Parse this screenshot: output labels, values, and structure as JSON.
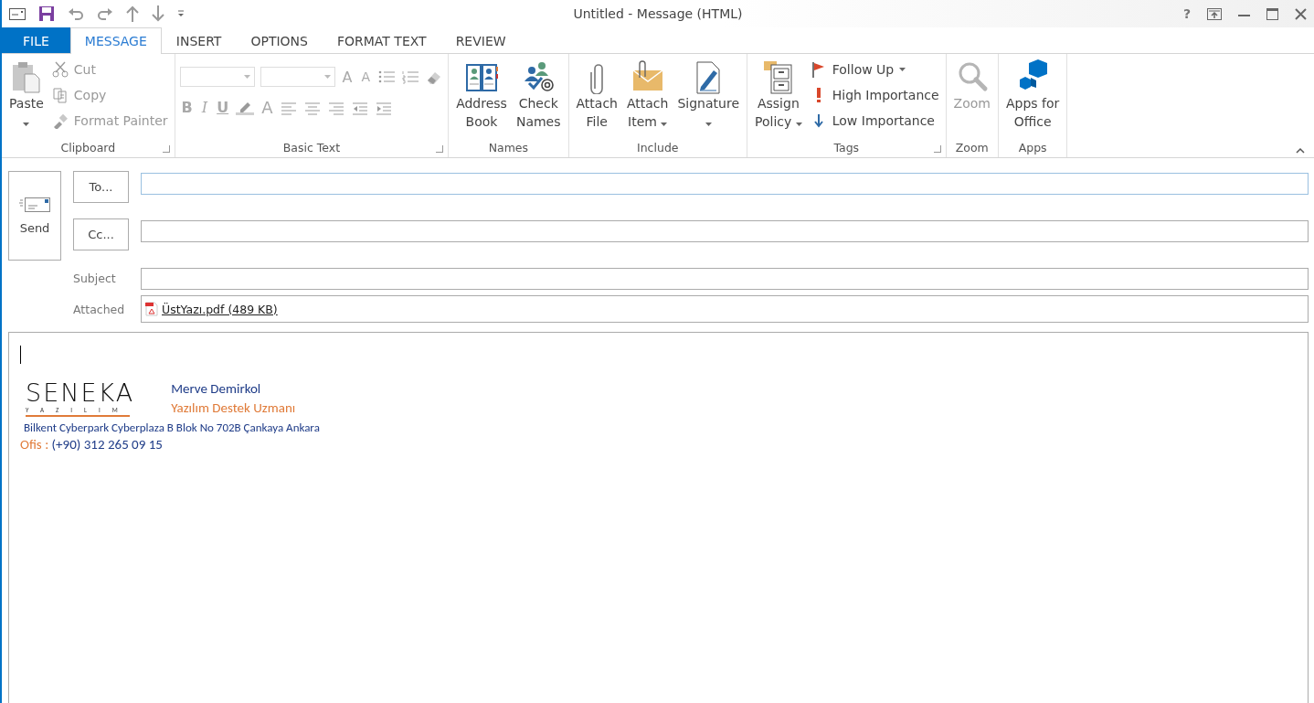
{
  "window": {
    "title": "Untitled - Message (HTML)",
    "help": "?"
  },
  "tabs": [
    {
      "label": "FILE",
      "kind": "file",
      "selected": false
    },
    {
      "label": "MESSAGE",
      "kind": "tab",
      "selected": true
    },
    {
      "label": "INSERT",
      "kind": "tab",
      "selected": false
    },
    {
      "label": "OPTIONS",
      "kind": "tab",
      "selected": false
    },
    {
      "label": "FORMAT TEXT",
      "kind": "tab",
      "selected": false
    },
    {
      "label": "REVIEW",
      "kind": "tab",
      "selected": false
    }
  ],
  "ribbon": {
    "groups": [
      {
        "label": "Clipboard",
        "launcher": true,
        "items": [
          {
            "kind": "paste",
            "lines": [
              "Paste"
            ],
            "dropdown": true,
            "disabled": false
          },
          {
            "kind": "cut",
            "label": "Cut",
            "disabled": true
          },
          {
            "kind": "copy",
            "label": "Copy",
            "disabled": true
          },
          {
            "kind": "painter",
            "label": "Format Painter",
            "disabled": true
          }
        ]
      },
      {
        "label": "Basic Text",
        "launcher": true,
        "disabled": true,
        "rows": [
          [
            {
              "kind": "combo"
            },
            {
              "kind": "combo"
            },
            {
              "kind": "grow",
              "text": "A"
            },
            {
              "kind": "shrink",
              "text": "A"
            },
            {
              "kind": "bullets"
            },
            {
              "kind": "numbering"
            },
            {
              "kind": "eraser"
            }
          ],
          [
            {
              "kind": "glyph",
              "text": "B"
            },
            {
              "kind": "italic",
              "text": "I"
            },
            {
              "kind": "underline",
              "text": "U"
            },
            {
              "kind": "highlighter"
            },
            {
              "kind": "fontcolor",
              "text": "A"
            },
            {
              "kind": "alignleft"
            },
            {
              "kind": "aligncenter"
            },
            {
              "kind": "alignright"
            },
            {
              "kind": "outdent"
            },
            {
              "kind": "indent"
            }
          ]
        ]
      },
      {
        "label": "Names",
        "items": [
          {
            "kind": "addressbook",
            "lines": [
              "Address",
              "Book"
            ],
            "disabled": false
          },
          {
            "kind": "checknames",
            "lines": [
              "Check",
              "Names"
            ],
            "disabled": false
          }
        ]
      },
      {
        "label": "Include",
        "items": [
          {
            "kind": "paperclip",
            "lines": [
              "Attach",
              "File"
            ],
            "disabled": false
          },
          {
            "kind": "attachitem",
            "lines": [
              "Attach",
              "Item"
            ],
            "dropdown": true,
            "disabled": false
          },
          {
            "kind": "signature",
            "lines": [
              "Signature"
            ],
            "dropdown": true,
            "disabled": false
          }
        ]
      },
      {
        "label": "Tags",
        "launcher": true,
        "items": [
          {
            "kind": "policy",
            "lines": [
              "Assign",
              "Policy"
            ],
            "dropdown": true,
            "disabled": false
          },
          {
            "kind": "flag",
            "label": "Follow Up",
            "dropdown": true,
            "disabled": false
          },
          {
            "kind": "high",
            "label": "High Importance",
            "disabled": false
          },
          {
            "kind": "low",
            "label": "Low Importance",
            "disabled": false
          }
        ]
      },
      {
        "label": "Zoom",
        "items": [
          {
            "kind": "zoom",
            "lines": [
              "Zoom"
            ],
            "disabled": true
          }
        ]
      },
      {
        "label": "Apps",
        "items": [
          {
            "kind": "apps",
            "lines": [
              "Apps for",
              "Office"
            ],
            "disabled": false
          }
        ]
      }
    ]
  },
  "compose": {
    "send": "Send",
    "to": "To...",
    "cc": "Cc...",
    "subject_label": "Subject",
    "attached_label": "Attached",
    "attachment": "ÜstYazı.pdf (489 KB)"
  },
  "signature": {
    "logo": "SENEKA",
    "logo_sub": "YAZILIM",
    "name": "Merve Demirkol",
    "role": "Yazılım Destek Uzmanı",
    "address": "Bilkent Cyberpark Cyberplaza B Blok No 702B Çankaya Ankara",
    "phone_label": "Ofis :",
    "phone": "(+90) 312 265 09 15"
  }
}
